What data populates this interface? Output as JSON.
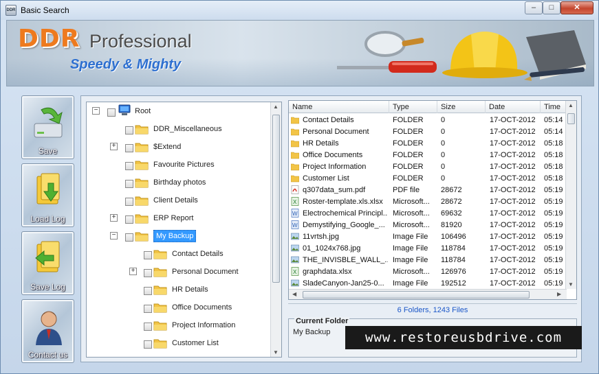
{
  "window": {
    "title": "Basic Search",
    "icon_text": "DDR",
    "buttons": {
      "minimize": "–",
      "maximize": "□",
      "close": "✕"
    }
  },
  "banner": {
    "brand_ddr": "DDR",
    "brand_pro": "Professional",
    "tagline": "Speedy & Mighty"
  },
  "sidebar": {
    "items": [
      {
        "label": "Save",
        "icon": "save-drive-icon"
      },
      {
        "label": "Load Log",
        "icon": "load-log-icon"
      },
      {
        "label": "Save Log",
        "icon": "save-log-icon"
      },
      {
        "label": "Contact us",
        "icon": "contact-person-icon"
      }
    ]
  },
  "tree": {
    "root": "Root",
    "nodes": [
      {
        "label": "DDR_Miscellaneous",
        "expandable": false
      },
      {
        "label": "$Extend",
        "expandable": true
      },
      {
        "label": "Favourite Pictures",
        "expandable": false
      },
      {
        "label": "Birthday photos",
        "expandable": false
      },
      {
        "label": "Client Details",
        "expandable": false
      },
      {
        "label": "ERP Report",
        "expandable": true
      },
      {
        "label": "My Backup",
        "expandable": true,
        "expanded": true,
        "selected": true
      }
    ],
    "children": [
      {
        "label": "Contact Details",
        "expandable": false
      },
      {
        "label": "Personal Document",
        "expandable": true
      },
      {
        "label": "HR Details",
        "expandable": false
      },
      {
        "label": "Office Documents",
        "expandable": false
      },
      {
        "label": "Project Information",
        "expandable": false
      },
      {
        "label": "Customer List",
        "expandable": false
      }
    ]
  },
  "list": {
    "columns": [
      "Name",
      "Type",
      "Size",
      "Date",
      "Time"
    ],
    "rows": [
      {
        "icon": "folder",
        "name": "Contact Details",
        "type": "FOLDER",
        "size": "0",
        "date": "17-OCT-2012",
        "time": "05:14"
      },
      {
        "icon": "folder",
        "name": "Personal Document",
        "type": "FOLDER",
        "size": "0",
        "date": "17-OCT-2012",
        "time": "05:14"
      },
      {
        "icon": "folder",
        "name": "HR Details",
        "type": "FOLDER",
        "size": "0",
        "date": "17-OCT-2012",
        "time": "05:18"
      },
      {
        "icon": "folder",
        "name": "Office Documents",
        "type": "FOLDER",
        "size": "0",
        "date": "17-OCT-2012",
        "time": "05:18"
      },
      {
        "icon": "folder",
        "name": "Project Information",
        "type": "FOLDER",
        "size": "0",
        "date": "17-OCT-2012",
        "time": "05:18"
      },
      {
        "icon": "folder",
        "name": "Customer List",
        "type": "FOLDER",
        "size": "0",
        "date": "17-OCT-2012",
        "time": "05:18"
      },
      {
        "icon": "pdf",
        "name": "q307data_sum.pdf",
        "type": "PDF file",
        "size": "28672",
        "date": "17-OCT-2012",
        "time": "05:19"
      },
      {
        "icon": "excel",
        "name": "Roster-template.xls.xlsx",
        "type": "Microsoft...",
        "size": "28672",
        "date": "17-OCT-2012",
        "time": "05:19"
      },
      {
        "icon": "word",
        "name": "Electrochemical Principl...",
        "type": "Microsoft...",
        "size": "69632",
        "date": "17-OCT-2012",
        "time": "05:19"
      },
      {
        "icon": "word",
        "name": "Demystifying_Google_...",
        "type": "Microsoft...",
        "size": "81920",
        "date": "17-OCT-2012",
        "time": "05:19"
      },
      {
        "icon": "image",
        "name": "11vrtsh.jpg",
        "type": "Image File",
        "size": "106496",
        "date": "17-OCT-2012",
        "time": "05:19"
      },
      {
        "icon": "image",
        "name": "01_1024x768.jpg",
        "type": "Image File",
        "size": "118784",
        "date": "17-OCT-2012",
        "time": "05:19"
      },
      {
        "icon": "image",
        "name": "THE_INVISBLE_WALL_...",
        "type": "Image File",
        "size": "118784",
        "date": "17-OCT-2012",
        "time": "05:19"
      },
      {
        "icon": "excel",
        "name": "graphdata.xlsx",
        "type": "Microsoft...",
        "size": "126976",
        "date": "17-OCT-2012",
        "time": "05:19"
      },
      {
        "icon": "image",
        "name": "SladeCanyon-Jan25-0...",
        "type": "Image File",
        "size": "192512",
        "date": "17-OCT-2012",
        "time": "05:19"
      }
    ]
  },
  "status": "6 Folders, 1243 Files",
  "current_folder": {
    "legend": "Current Folder",
    "path": "My Backup"
  },
  "watermark": "www.restoreusbdrive.com",
  "colors": {
    "accent_orange": "#ee7a1e",
    "tagline_blue": "#2d6fd0",
    "status_blue": "#1a56c8",
    "selection": "#3399ff"
  }
}
